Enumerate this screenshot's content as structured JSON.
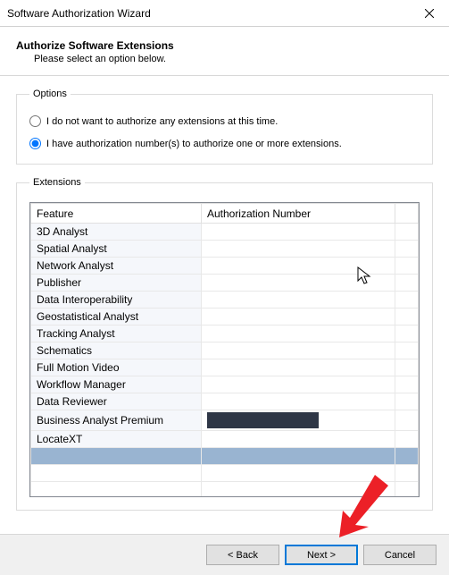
{
  "titlebar": {
    "title": "Software Authorization Wizard"
  },
  "header": {
    "title": "Authorize Software Extensions",
    "subtitle": "Please select an option below."
  },
  "options": {
    "legend": "Options",
    "opt1_label": "I do not want to authorize any extensions at this time.",
    "opt2_label": "I have authorization number(s) to authorize one or more extensions."
  },
  "extensions": {
    "legend": "Extensions",
    "col_feature": "Feature",
    "col_authnum": "Authorization Number",
    "rows": [
      {
        "feature": "3D Analyst",
        "auth": ""
      },
      {
        "feature": "Spatial Analyst",
        "auth": ""
      },
      {
        "feature": "Network Analyst",
        "auth": ""
      },
      {
        "feature": "Publisher",
        "auth": ""
      },
      {
        "feature": "Data Interoperability",
        "auth": ""
      },
      {
        "feature": "Geostatistical Analyst",
        "auth": ""
      },
      {
        "feature": "Tracking Analyst",
        "auth": ""
      },
      {
        "feature": "Schematics",
        "auth": ""
      },
      {
        "feature": "Full Motion Video",
        "auth": ""
      },
      {
        "feature": "Workflow Manager",
        "auth": ""
      },
      {
        "feature": "Data Reviewer",
        "auth": ""
      },
      {
        "feature": "Business Analyst Premium",
        "auth": "[redacted]"
      },
      {
        "feature": "LocateXT",
        "auth": ""
      }
    ]
  },
  "footer": {
    "back": "< Back",
    "next": "Next >",
    "cancel": "Cancel"
  }
}
